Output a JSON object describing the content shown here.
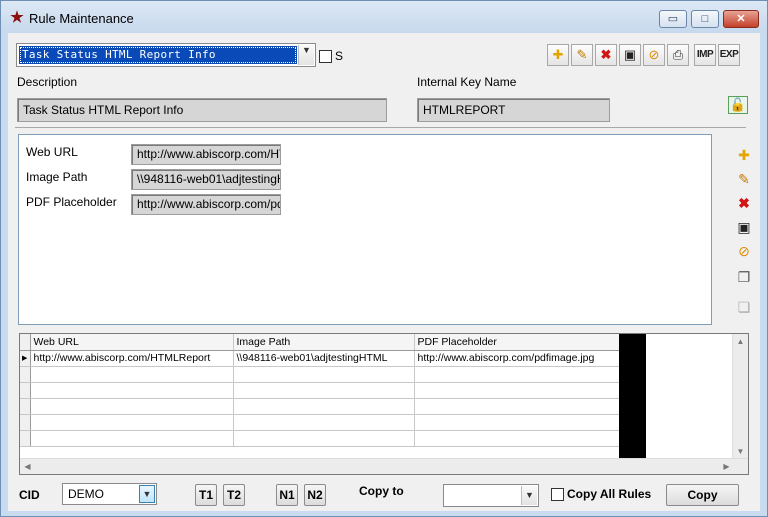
{
  "window": {
    "title": "Rule Maintenance",
    "min_glyph": "▭",
    "max_glyph": "□",
    "close_glyph": "✕"
  },
  "header": {
    "rule_selected": "Task Status HTML Report Info",
    "s_checkbox_label": "S",
    "toolbar": {
      "imp_label": "IMP",
      "exp_label": "EXP"
    }
  },
  "form": {
    "description_label": "Description",
    "description_value": "Task Status HTML Report Info",
    "internal_key_label": "Internal Key Name",
    "internal_key_value": "HTMLREPORT"
  },
  "detail": {
    "fields": [
      {
        "label": "Web URL",
        "value": "http://www.abiscorp.com/HTMLReport"
      },
      {
        "label": "Image Path",
        "value": "\\\\948116-web01\\adjtestingHTML"
      },
      {
        "label": "PDF Placeholder",
        "value": "http://www.abiscorp.com/pdfimage.jpg"
      }
    ]
  },
  "grid": {
    "columns": [
      "Web URL",
      "Image Path",
      "PDF Placeholder"
    ],
    "rows": [
      [
        "http://www.abiscorp.com/HTMLReport",
        "\\\\948116-web01\\adjtestingHTML",
        "http://www.abiscorp.com/pdfimage.jpg"
      ]
    ],
    "current_row_marker": "▶"
  },
  "footer": {
    "cid_label": "CID",
    "cid_value": "DEMO",
    "t1_label": "T1",
    "t2_label": "T2",
    "n1_label": "N1",
    "n2_label": "N2",
    "copy_to_label": "Copy to",
    "copy_to_value": "",
    "copy_all_label": "Copy All Rules",
    "copy_button_label": "Copy"
  },
  "colors": {
    "selection": "#0a49b8",
    "readonly_bg": "#d6d6d6",
    "titlebar": "#c9dbee"
  },
  "icons": {
    "app": "star-icon",
    "new": "new-document-icon",
    "edit": "edit-icon",
    "delete": "delete-x-icon",
    "save": "floppy-disk-icon",
    "cancel": "cancel-circle-icon",
    "print": "printer-icon",
    "unlock": "unlocked-padlock-icon"
  }
}
